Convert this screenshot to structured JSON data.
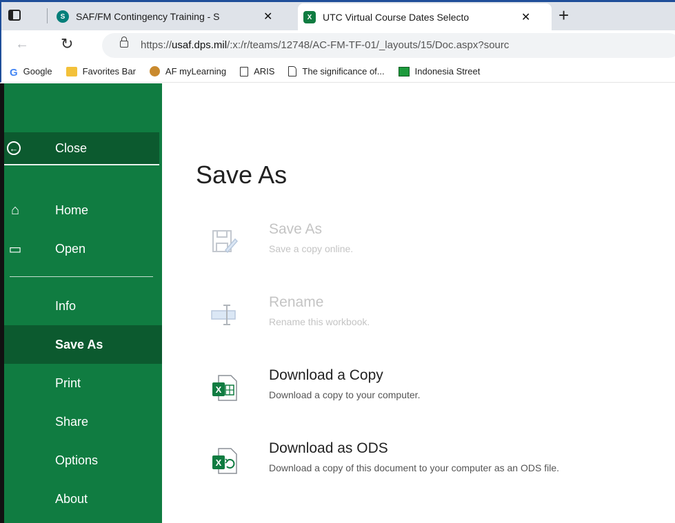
{
  "browser": {
    "tabs": [
      {
        "title": "SAF/FM Contingency Training - S",
        "favicon": "sharepoint-icon",
        "close": "✕",
        "active": false
      },
      {
        "title": "UTC Virtual Course Dates Selecto",
        "favicon": "excel-icon",
        "close": "✕",
        "active": true
      }
    ],
    "new_tab": "+",
    "url_prefix": "https://",
    "url_host": "usaf.dps.mil",
    "url_path": "/:x:/r/teams/12748/AC-FM-TF-01/_layouts/15/Doc.aspx?sourc",
    "favorites": [
      {
        "label": "Google",
        "icon": "google-icon"
      },
      {
        "label": "Favorites Bar",
        "icon": "folder-icon"
      },
      {
        "label": "AF myLearning",
        "icon": "mylearning-icon"
      },
      {
        "label": "ARIS",
        "icon": "document-icon"
      },
      {
        "label": "The significance of...",
        "icon": "page-icon"
      },
      {
        "label": "Indonesia Street",
        "icon": "green-arrow-icon"
      }
    ]
  },
  "backstage": {
    "close_label": "Close",
    "nav": [
      {
        "label": "Home",
        "icon": "home-icon"
      },
      {
        "label": "Open",
        "icon": "folder-open-icon"
      },
      {
        "label": "Info"
      },
      {
        "label": "Save As",
        "selected": true
      },
      {
        "label": "Print"
      },
      {
        "label": "Share"
      },
      {
        "label": "Options"
      },
      {
        "label": "About"
      }
    ],
    "title": "Save As",
    "actions": [
      {
        "title": "Save As",
        "desc": "Save a copy online.",
        "icon": "save-as-icon",
        "enabled": false
      },
      {
        "title": "Rename",
        "desc": "Rename this workbook.",
        "icon": "rename-icon",
        "enabled": false
      },
      {
        "title": "Download a Copy",
        "desc": "Download a copy to your computer.",
        "icon": "excel-download-icon",
        "enabled": true
      },
      {
        "title": "Download as ODS",
        "desc": "Download a copy of this document to your computer as an ODS file.",
        "icon": "ods-download-icon",
        "enabled": true
      }
    ]
  },
  "colors": {
    "sidebar": "#107c41",
    "sidebar_selected": "#0c5a2f",
    "excel_green": "#107c41"
  }
}
